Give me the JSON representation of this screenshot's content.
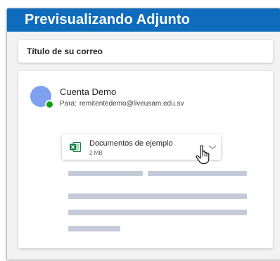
{
  "window": {
    "title": "Previsualizando Adjunto"
  },
  "email": {
    "subject": "Título de su correo",
    "sender_name": "Cuenta Demo",
    "to_label": "Para:",
    "to_address": "remitentedemo@liveusam.edu.sv",
    "avatar_color": "#7da1f0",
    "presence_status": "available",
    "presence_color": "#13a10e"
  },
  "attachment": {
    "file_name": "Documentos de ejemplo",
    "file_size": "2 MB",
    "file_type_icon": "excel-file-icon",
    "expand_icon": "chevron-down-icon"
  },
  "cursor": {
    "icon": "hand-pointer-icon"
  },
  "colors": {
    "accent": "#0f6cbd",
    "placeholder": "#c4cad8",
    "background": "#f2f2f2"
  }
}
